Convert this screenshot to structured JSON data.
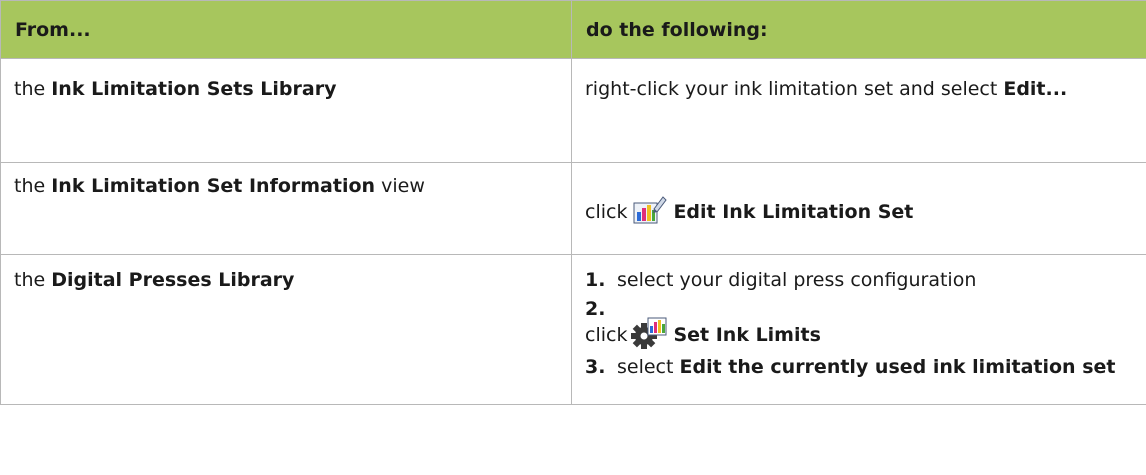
{
  "table": {
    "header_from": "From...",
    "header_do": "do the following:",
    "rows": [
      {
        "from_prefix": "the ",
        "from_bold": "Ink Limitation Sets Library",
        "from_suffix": "",
        "do_text": "right-click your ink limitation set and select ",
        "do_bold": "Edit..."
      },
      {
        "from_prefix": "the ",
        "from_bold": "Ink Limitation Set Information",
        "from_suffix": " view",
        "do_prefix": "click ",
        "do_icon": "edit-ink-limitation-set-icon",
        "do_bold": "Edit Ink Limitation Set"
      },
      {
        "from_prefix": "the ",
        "from_bold": "Digital Presses Library",
        "from_suffix": "",
        "steps": [
          {
            "num": "1.",
            "text": "select your digital press configuration"
          },
          {
            "num": "2.",
            "prefix": "click ",
            "icon": "set-ink-limits-gear-icon",
            "bold": "Set Ink Limits"
          },
          {
            "num": "3.",
            "prefix": "select ",
            "bold": "Edit the currently used ink limitation set"
          }
        ]
      }
    ]
  },
  "colors": {
    "header_bg": "#a7c65d",
    "border": "#b8b8b8"
  }
}
